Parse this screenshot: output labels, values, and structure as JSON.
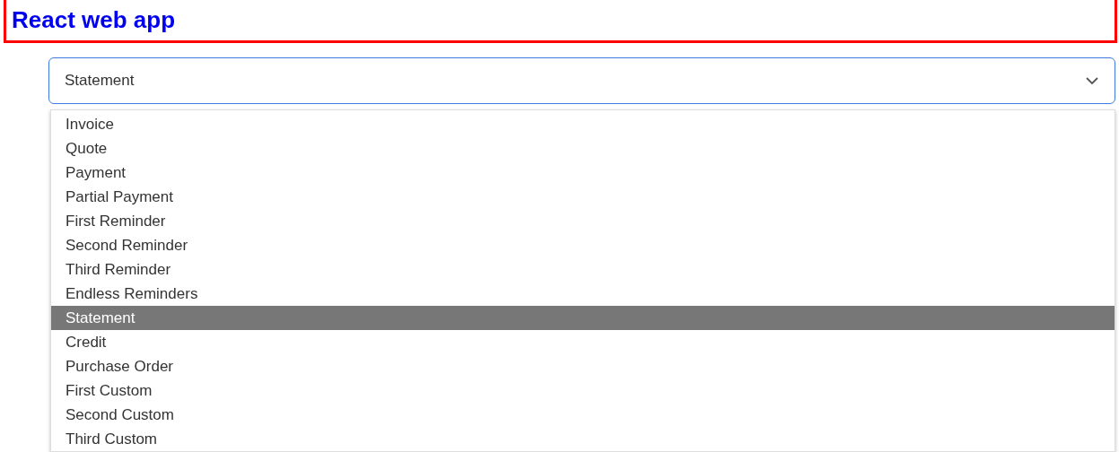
{
  "header": {
    "title": "React web app"
  },
  "select": {
    "value": "Statement",
    "expanded": true
  },
  "options": [
    {
      "label": "Invoice",
      "selected": false
    },
    {
      "label": "Quote",
      "selected": false
    },
    {
      "label": "Payment",
      "selected": false
    },
    {
      "label": "Partial Payment",
      "selected": false
    },
    {
      "label": "First Reminder",
      "selected": false
    },
    {
      "label": "Second Reminder",
      "selected": false
    },
    {
      "label": "Third Reminder",
      "selected": false
    },
    {
      "label": "Endless Reminders",
      "selected": false
    },
    {
      "label": "Statement",
      "selected": true
    },
    {
      "label": "Credit",
      "selected": false
    },
    {
      "label": "Purchase Order",
      "selected": false
    },
    {
      "label": "First Custom",
      "selected": false
    },
    {
      "label": "Second Custom",
      "selected": false
    },
    {
      "label": "Third Custom",
      "selected": false
    }
  ]
}
